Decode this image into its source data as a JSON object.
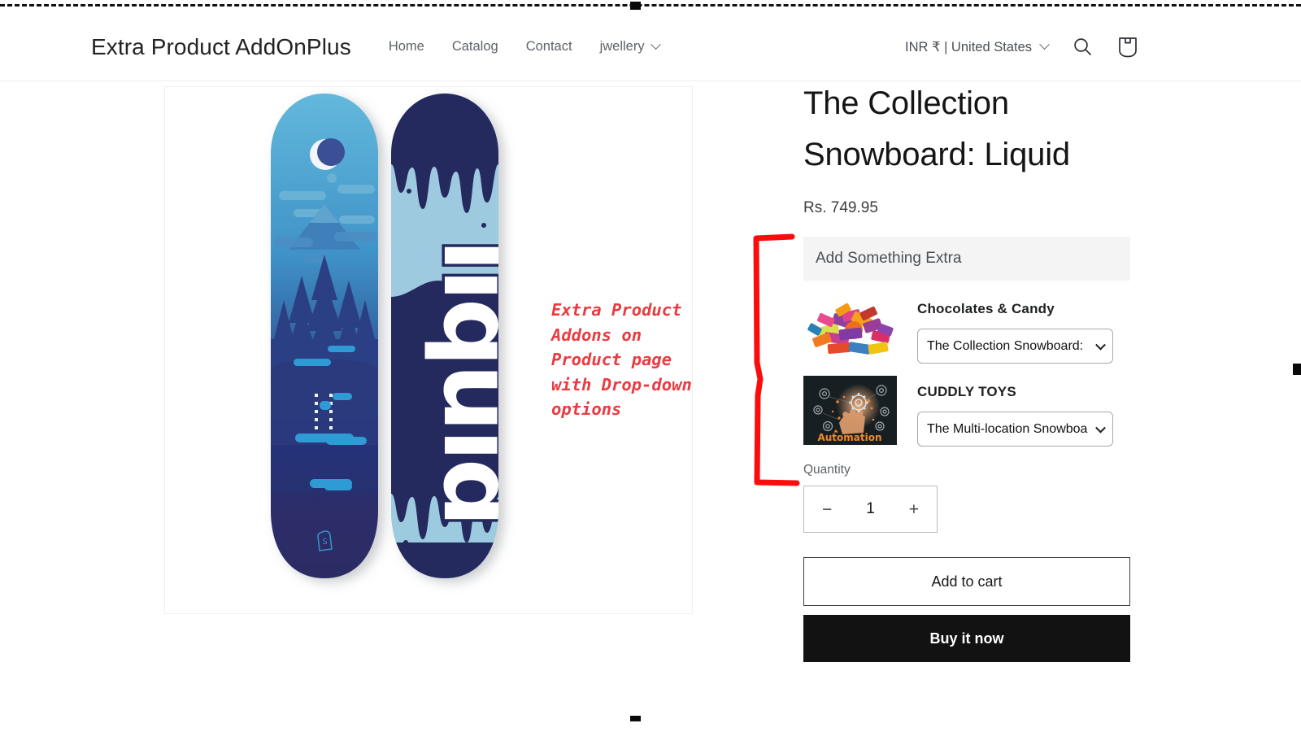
{
  "header": {
    "brand": "Extra Product AddOnPlus",
    "nav": [
      {
        "label": "Home"
      },
      {
        "label": "Catalog"
      },
      {
        "label": "Contact"
      },
      {
        "label": "jwellery",
        "has_dropdown": true
      }
    ],
    "locale": "INR ₹ | United States",
    "icons": {
      "locale_chevron": "chevron-down-icon",
      "search": "search-icon",
      "cart": "cart-icon"
    }
  },
  "media": {
    "alt": "The Collection Snowboard: Liquid — two snowboards, moonlit forest graphic and liquid drip graphic",
    "watermark": "shopify-logo"
  },
  "annotation": {
    "text": "Extra Product\nAddons on\nProduct page\nwith Drop-down\noptions",
    "color": "#ea3b41",
    "bracket": "red-bracket"
  },
  "product": {
    "title": "The Collection Snowboard: Liquid",
    "price": "Rs. 749.95"
  },
  "addons": {
    "section_label": "Add Something Extra",
    "items": [
      {
        "title": "Chocolates & Candy",
        "thumb": "candy-assortment-image",
        "selected_option": "The Collection Snowboard:"
      },
      {
        "title": "CUDDLY TOYS",
        "thumb": "automation-gears-image",
        "thumb_caption": "Automation",
        "selected_option": "The Multi-location Snowboa"
      }
    ]
  },
  "quantity": {
    "label": "Quantity",
    "decrease": "−",
    "value": "1",
    "increase": "+"
  },
  "actions": {
    "add_to_cart": "Add to cart",
    "buy_it_now": "Buy it now"
  }
}
